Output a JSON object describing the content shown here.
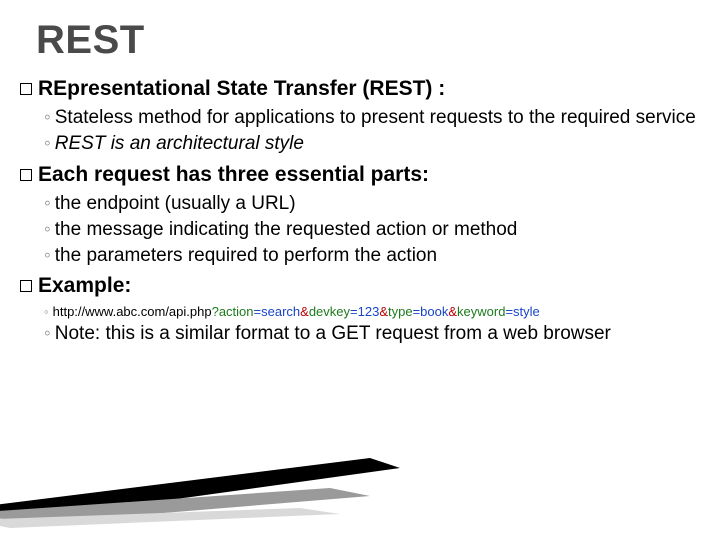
{
  "title": "REST",
  "b1": {
    "head": "REpresentational State Transfer (REST) :",
    "s1": "Stateless method for applications to present requests to the required service",
    "s2": "REST is an architectural style"
  },
  "b2": {
    "head": "Each request has three essential parts:",
    "s1": "the endpoint (usually a URL)",
    "s2": "the message indicating the requested action or method",
    "s3": "the parameters required to perform the action"
  },
  "b3": {
    "head": "Example:",
    "url": {
      "base": "http://www.abc.com/api.php",
      "q1k": "?action",
      "q1v": "=search",
      "amp": "&",
      "q2k": "devkey",
      "q2v": "=123",
      "q3k": "type",
      "q3v": "=book",
      "q4k": "keyword",
      "q4v": "=style"
    },
    "s2": "Note: this is a similar format to a GET request from a web browser"
  }
}
